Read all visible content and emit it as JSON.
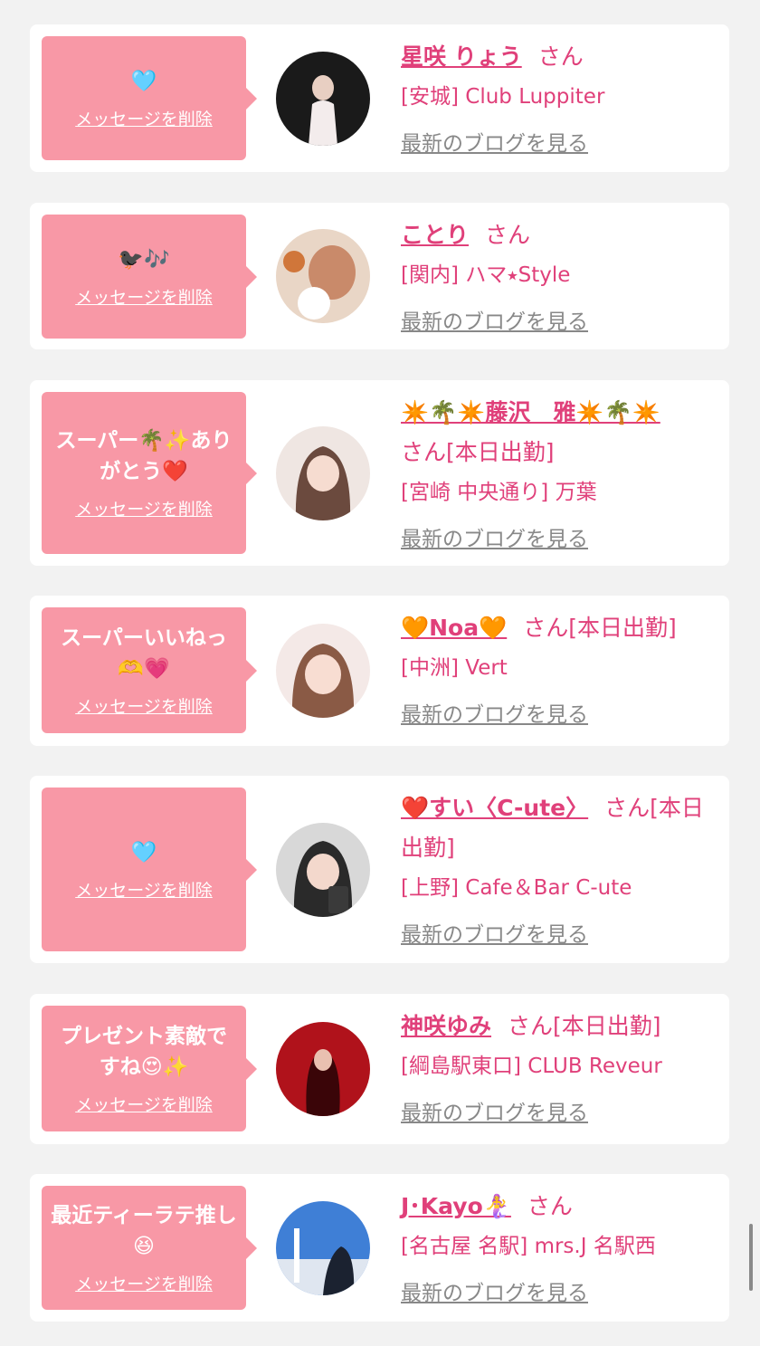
{
  "cards": [
    {
      "message": "🩵",
      "delete_label": "メッセージを削除",
      "name": "星咲 りょう",
      "san": "さん",
      "shop": "[安城] Club Luppiter",
      "blog_link": "最新のブログを見る",
      "avatar_colors": [
        "#1a1a1a",
        "#f3ecec"
      ]
    },
    {
      "message": "🐦‍⬛🎶",
      "delete_label": "メッセージを削除",
      "name": "ことり",
      "san": "さん",
      "shop": "[関内] ハマ⭑Style",
      "blog_link": "最新のブログを見る",
      "avatar_colors": [
        "#e9d6c6",
        "#c98a6a"
      ]
    },
    {
      "message": "スーパー🌴✨ありがとう❤️",
      "delete_label": "メッセージを削除",
      "name": "✴️🌴✴️藤沢　雅✴️🌴✴️",
      "san": "さん[本日出勤]",
      "shop": "[宮崎 中央通り] 万葉",
      "blog_link": "最新のブログを見る",
      "avatar_colors": [
        "#efe6e2",
        "#6b4a3e"
      ]
    },
    {
      "message": "スーパーいいねっ🫶💗",
      "delete_label": "メッセージを削除",
      "name": "🧡Noa🧡",
      "san": "さん[本日出勤]",
      "shop": "[中洲] Vert",
      "blog_link": "最新のブログを見る",
      "avatar_colors": [
        "#f4e9e7",
        "#8a5a45"
      ]
    },
    {
      "message": "🩵",
      "delete_label": "メッセージを削除",
      "name": "❤️すい〈C-ute〉",
      "san": "さん[本日出勤]",
      "shop": "[上野] Cafe＆Bar C-ute",
      "blog_link": "最新のブログを見る",
      "avatar_colors": [
        "#d8d8d8",
        "#2a2a2a"
      ]
    },
    {
      "message": "プレゼント素敵ですね😍✨",
      "delete_label": "メッセージを削除",
      "name": "神咲ゆみ",
      "san": "さん[本日出勤]",
      "shop": "[綱島駅東口] CLUB Reveur",
      "blog_link": "最新のブログを見る",
      "avatar_colors": [
        "#b0121b",
        "#3a0508"
      ]
    },
    {
      "message": "最近ティーラテ推し😆",
      "delete_label": "メッセージを削除",
      "name": "J･Kayo🧜‍♀️",
      "san": "さん",
      "shop": "[名古屋 名駅] mrs.J 名駅西",
      "blog_link": "最新のブログを見る",
      "avatar_colors": [
        "#3f7fd6",
        "#1b2230"
      ]
    }
  ],
  "colors": {
    "bubble": "#f898a6",
    "accent": "#e0407a",
    "link_gray": "#888888",
    "background": "#f2f2f2"
  }
}
